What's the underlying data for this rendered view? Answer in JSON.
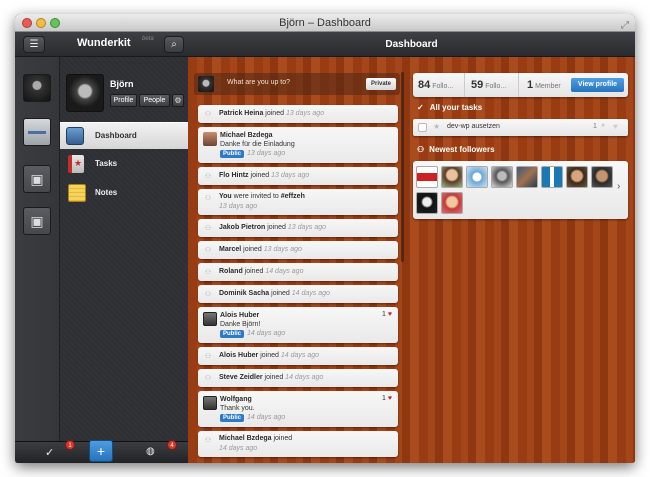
{
  "window": {
    "title": "Björn – Dashboard"
  },
  "sidebar": {
    "app_title": "Wunderkit",
    "app_tag": "beta",
    "user_name": "Björn",
    "profile_label": "Profile",
    "people_label": "People",
    "nav": [
      {
        "label": "Dashboard"
      },
      {
        "label": "Tasks"
      },
      {
        "label": "Notes"
      }
    ]
  },
  "bottom": {
    "check_badge": "1",
    "globe_badge": "4"
  },
  "main": {
    "title": "Dashboard"
  },
  "compose": {
    "placeholder": "What are you up to?",
    "privacy_label": "Private"
  },
  "feed": [
    {
      "name": "Patrick Heina",
      "action": " joined",
      "time": "13 days ago"
    },
    {
      "name": "Michael Bzdega",
      "text": "Danke für die Einladung",
      "badge": "Public",
      "time": "13 days ago"
    },
    {
      "name": "Flo Hintz",
      "action": " joined",
      "time": "13 days ago"
    },
    {
      "name": "You",
      "action": " were invited to ",
      "target": "#effzeh",
      "time": "13 days ago"
    },
    {
      "name": "Jakob Pietron",
      "action": " joined",
      "time": "13 days ago"
    },
    {
      "name": "Marcel",
      "action": " joined",
      "time": "13 days ago"
    },
    {
      "name": "Roland",
      "action": " joined",
      "time": "14 days ago"
    },
    {
      "name": "Dominik Sacha",
      "action": " joined",
      "time": "14 days ago"
    },
    {
      "name": "Alois Huber",
      "text": "Danke Björn!",
      "badge": "Public",
      "time": "14 days ago",
      "likes": "1"
    },
    {
      "name": "Alois Huber",
      "action": " joined",
      "time": "14 days ago"
    },
    {
      "name": "Steve Zeidler",
      "action": " joined",
      "time": "14 days ago"
    },
    {
      "name": "Wolfgang",
      "text": "Thank you.",
      "badge": "Public",
      "time": "14 days ago",
      "likes": "1"
    },
    {
      "name": "Michael Bzdega",
      "action": " joined",
      "time": "14 days ago"
    }
  ],
  "stats": {
    "followers_count": "84",
    "followers_label": "Follo...",
    "following_count": "59",
    "following_label": "Follo...",
    "member_count": "1",
    "member_label": "Member",
    "view_profile": "View profile"
  },
  "tasks": {
    "header": "All your tasks",
    "items": [
      {
        "label": "dev-wp ausetzen",
        "count": "1"
      }
    ]
  },
  "followers": {
    "header": "Newest followers",
    "count_shown": 10
  },
  "colors": {
    "accent_blue": "#2f7ac8",
    "badge_red": "#d23a2c",
    "wood": "#9a3c13"
  }
}
